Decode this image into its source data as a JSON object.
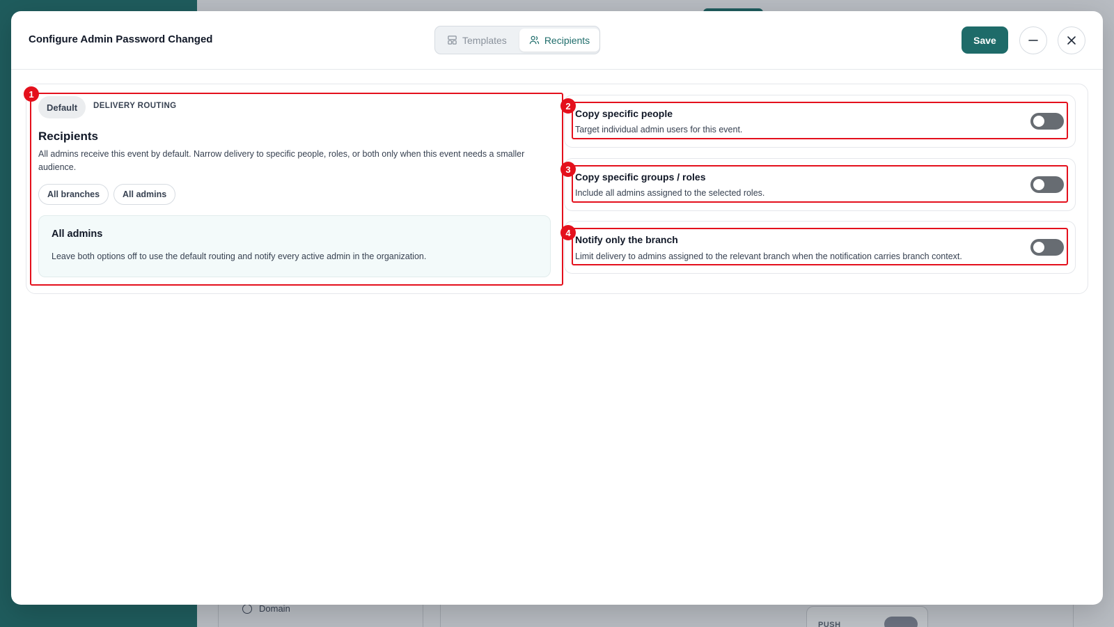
{
  "background": {
    "domain_label": "Domain",
    "push_label": "PUSH"
  },
  "modal": {
    "title": "Configure Admin Password Changed",
    "tabs": [
      {
        "label": "Templates",
        "icon": "layout-icon",
        "active": false
      },
      {
        "label": "Recipients",
        "icon": "users-icon",
        "active": true
      }
    ],
    "save_label": "Save"
  },
  "routing": {
    "chip_label": "Default",
    "section_label": "DELIVERY ROUTING",
    "title": "Recipients",
    "description": "All admins receive this event by default. Narrow delivery to specific people, roles, or both only when this event needs a smaller audience.",
    "scope_pills": [
      "All branches",
      "All admins"
    ],
    "info": {
      "title": "All admins",
      "description": "Leave both options off to use the default routing and notify every active admin in the organization."
    }
  },
  "options": [
    {
      "title": "Copy specific people",
      "description": "Target individual admin users for this event.",
      "enabled": false
    },
    {
      "title": "Copy specific groups / roles",
      "description": "Include all admins assigned to the selected roles.",
      "enabled": false
    },
    {
      "title": "Notify only the branch",
      "description": "Limit delivery to admins assigned to the relevant branch when the notification carries branch context.",
      "enabled": false
    }
  ],
  "annotations": [
    "1",
    "2",
    "3",
    "4"
  ],
  "colors": {
    "accent": "#1e6b69",
    "sidebar": "#1f5c5d",
    "highlight": "#e4101c",
    "toggle_off": "#676c72"
  }
}
